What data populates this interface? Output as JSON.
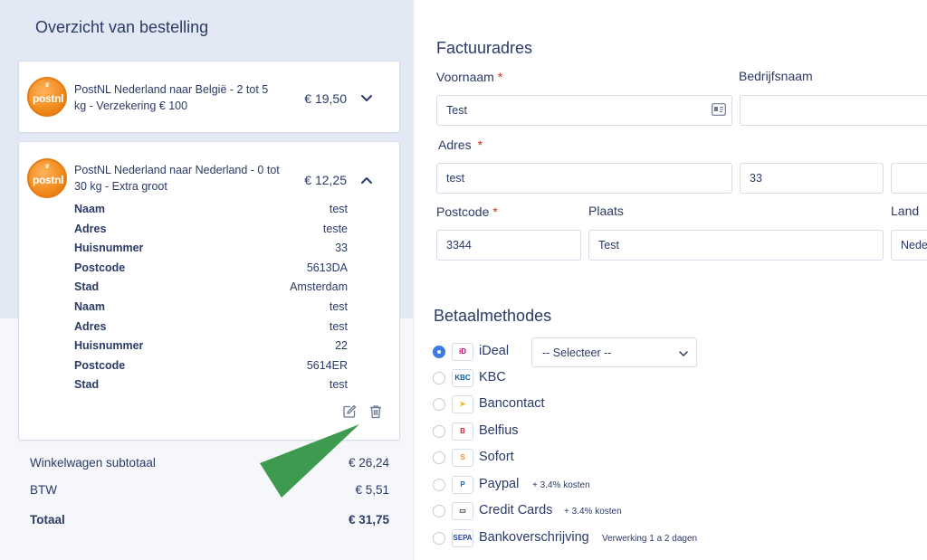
{
  "order_summary": {
    "title": "Overzicht van bestelling",
    "logo_text": "post",
    "logo_text_suffix": "nl",
    "items": [
      {
        "title_line1": "PostNL Nederland naar België - 2 tot 5",
        "title_line2": "kg - Verzekering € 100",
        "price": "€ 19,50",
        "expanded": false
      },
      {
        "title_line1": "PostNL Nederland naar Nederland - 0 tot",
        "title_line2": "30 kg - Extra groot",
        "price": "€ 12,25",
        "expanded": true
      }
    ],
    "details": [
      {
        "label": "Naam",
        "value": "test"
      },
      {
        "label": "Adres",
        "value": "teste"
      },
      {
        "label": "Huisnummer",
        "value": "33"
      },
      {
        "label": "Postcode",
        "value": "5613DA"
      },
      {
        "label": "Stad",
        "value": "Amsterdam"
      },
      {
        "label": "Naam",
        "value": "test"
      },
      {
        "label": "Adres",
        "value": "test"
      },
      {
        "label": "Huisnummer",
        "value": "22"
      },
      {
        "label": "Postcode",
        "value": "5614ER"
      },
      {
        "label": "Stad",
        "value": "test"
      }
    ],
    "totals": [
      {
        "label": "Winkelwagen subtotaal",
        "value": "€ 26,24"
      },
      {
        "label": "BTW",
        "value": "€ 5,51"
      },
      {
        "label": "Totaal",
        "value": "€ 31,75"
      }
    ]
  },
  "billing": {
    "title": "Factuuradres",
    "labels": {
      "first_name": "Voornaam",
      "company": "Bedrijfsnaam",
      "address": "Adres",
      "postcode": "Postcode",
      "city": "Plaats",
      "country": "Land"
    },
    "required_mark": "*",
    "values": {
      "first_name": "Test",
      "company": "",
      "address": "test",
      "house_number": "33",
      "addition": "",
      "postcode": "3344",
      "city": "Test",
      "country": "Nede"
    }
  },
  "payment": {
    "title": "Betaalmethodes",
    "select_placeholder": "-- Selecteer --",
    "methods": [
      {
        "name": "iDeal",
        "selected": true,
        "note": "",
        "logo": "iD",
        "logo_color": "#cc0066"
      },
      {
        "name": "KBC",
        "selected": false,
        "note": "",
        "logo": "KBC",
        "logo_color": "#0a5ea8"
      },
      {
        "name": "Bancontact",
        "selected": false,
        "note": "",
        "logo": "➤",
        "logo_color": "#f5b400"
      },
      {
        "name": "Belfius",
        "selected": false,
        "note": "",
        "logo": "B",
        "logo_color": "#d61f3c"
      },
      {
        "name": "Sofort",
        "selected": false,
        "note": "",
        "logo": "S",
        "logo_color": "#f08a1c"
      },
      {
        "name": "Paypal",
        "selected": false,
        "note": "+ 3.4% kosten",
        "logo": "P",
        "logo_color": "#1f5fc4"
      },
      {
        "name": "Credit Cards",
        "selected": false,
        "note": "+ 3.4% kosten",
        "logo": "▭",
        "logo_color": "#333333"
      },
      {
        "name": "Bankoverschrijving",
        "selected": false,
        "note": "Verwerking 1 a 2 dagen",
        "logo": "SEPA",
        "logo_color": "#2b4aa8"
      }
    ]
  },
  "colors": {
    "text": "#2b3a67",
    "required": "#d0321e",
    "radio_selected": "#3b7be4",
    "arrow": "#3d9a4f",
    "left_panel_bg": "#e3e9f4"
  }
}
